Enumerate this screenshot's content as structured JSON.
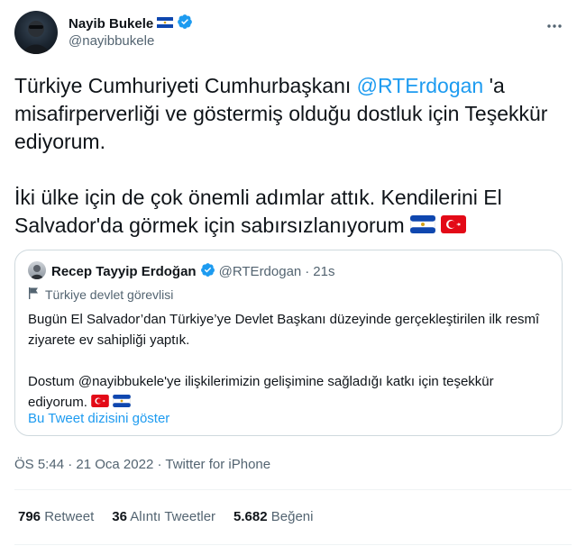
{
  "author": {
    "display_name": "Nayib Bukele",
    "handle": "@nayibbukele"
  },
  "tweet": {
    "text_part1": "Türkiye Cumhuriyeti Cumhurbaşkanı ",
    "mention": "@RTErdogan",
    "text_part2": " 'a misafirperverliği ve göstermiş olduğu dostluk için Teşekkür ediyorum.",
    "paragraph2": "İki ülke için de çok önemli adımlar attık. Kendilerini El Salvador'da görmek için sabırsızlanıyorum"
  },
  "quote": {
    "display_name": "Recep Tayyip Erdoğan",
    "handle": "@RTErdogan",
    "separator": "·",
    "time": "21s",
    "label": "Türkiye devlet görevlisi",
    "paragraph1": "Bugün El Salvador’dan Türkiye’ye Devlet Başkanı düzeyinde gerçekleştirilen ilk resmî ziyarete ev sahipliği yaptık.",
    "paragraph2": "Dostum @nayibbukele'ye ilişkilerimizin gelişimine sağladığı katkı için teşekkür ediyorum.",
    "show_thread": "Bu Tweet dizisini göster"
  },
  "meta": {
    "time": "ÖS 5:44",
    "separator": "·",
    "date": "21 Oca 2022",
    "source": "Twitter for iPhone"
  },
  "stats": [
    {
      "count": "796",
      "label": "Retweet"
    },
    {
      "count": "36",
      "label": "Alıntı Tweetler"
    },
    {
      "count": "5.682",
      "label": "Beğeni"
    }
  ],
  "colors": {
    "accent": "#1d9bf0",
    "text": "#0f1419",
    "muted": "#536471",
    "border": "#cfd9de"
  },
  "icons": [
    "el-salvador-flag-icon",
    "verified-badge-icon",
    "more-options-icon",
    "turkey-flag-icon",
    "government-flag-icon"
  ]
}
